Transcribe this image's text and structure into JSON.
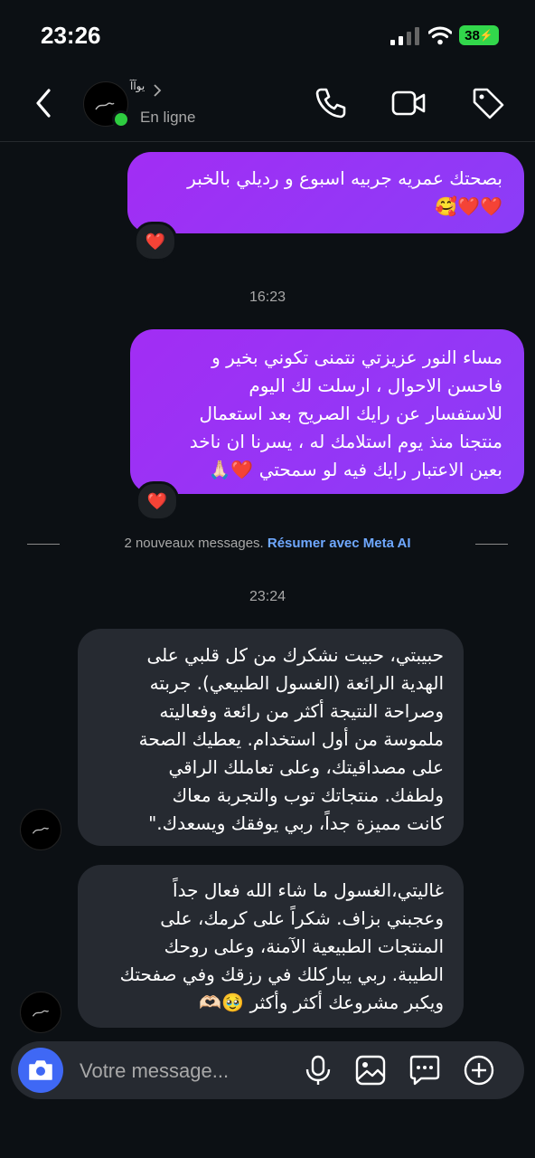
{
  "status": {
    "time": "23:26",
    "battery": "38"
  },
  "header": {
    "contact_name": "ﯾﻮآآ",
    "presence": "En ligne"
  },
  "messages": {
    "m1": {
      "text": "بصحتك عمريه جربيه اسبوع و رديلي بالخبر\n❤️❤️🥰",
      "reaction": "❤️"
    },
    "time1": "16:23",
    "m2": {
      "text": "مساء النور عزيزتي نتمنى تكوني بخير  و\nفاحسن الاحوال ، ارسلت لك اليوم\nللاستفسار عن رايك الصريح بعد استعمال\nمنتجنا منذ يوم استلامك له ، يسرنا ان ناخد\nبعين الاعتبار رايك فيه لو سمحتي ❤️🙏🏻",
      "reaction": "❤️"
    },
    "new_messages": "2 nouveaux messages.",
    "summarize": "Résumer avec Meta AI",
    "time2": "23:24",
    "m3": {
      "text": "حبيبتي، حبيت نشكرك من كل قلبي على\nالهدية الرائعة (الغسول الطبيعي). جربته\nوصراحة النتيجة أكثر من رائعة وفعاليته\nملموسة من أول استخدام. يعطيك الصحة\nعلى مصداقيتك، وعلى تعاملك الراقي\nولطفك. منتجاتك توب والتجربة معاك\nكانت مميزة جداً، ربي يوفقك ويسعدك.\""
    },
    "m4": {
      "text": "غاليتي،الغسول ما شاء الله فعال جداً\nوعجبني بزاف. شكراً على كرمك، على\nالمنتجات الطبيعية الآمنة، وعلى روحك\nالطيبة. ربي يباركلك في رزقك وفي صفحتك\nويكبر مشروعك أكثر وأكثر 🥹🫶🏻"
    }
  },
  "composer": {
    "placeholder": "Votre message..."
  },
  "icons": [
    "back-icon",
    "phone-icon",
    "video-icon",
    "tag-icon",
    "camera-icon",
    "microphone-icon",
    "gallery-icon",
    "sticker-icon",
    "plus-icon"
  ]
}
